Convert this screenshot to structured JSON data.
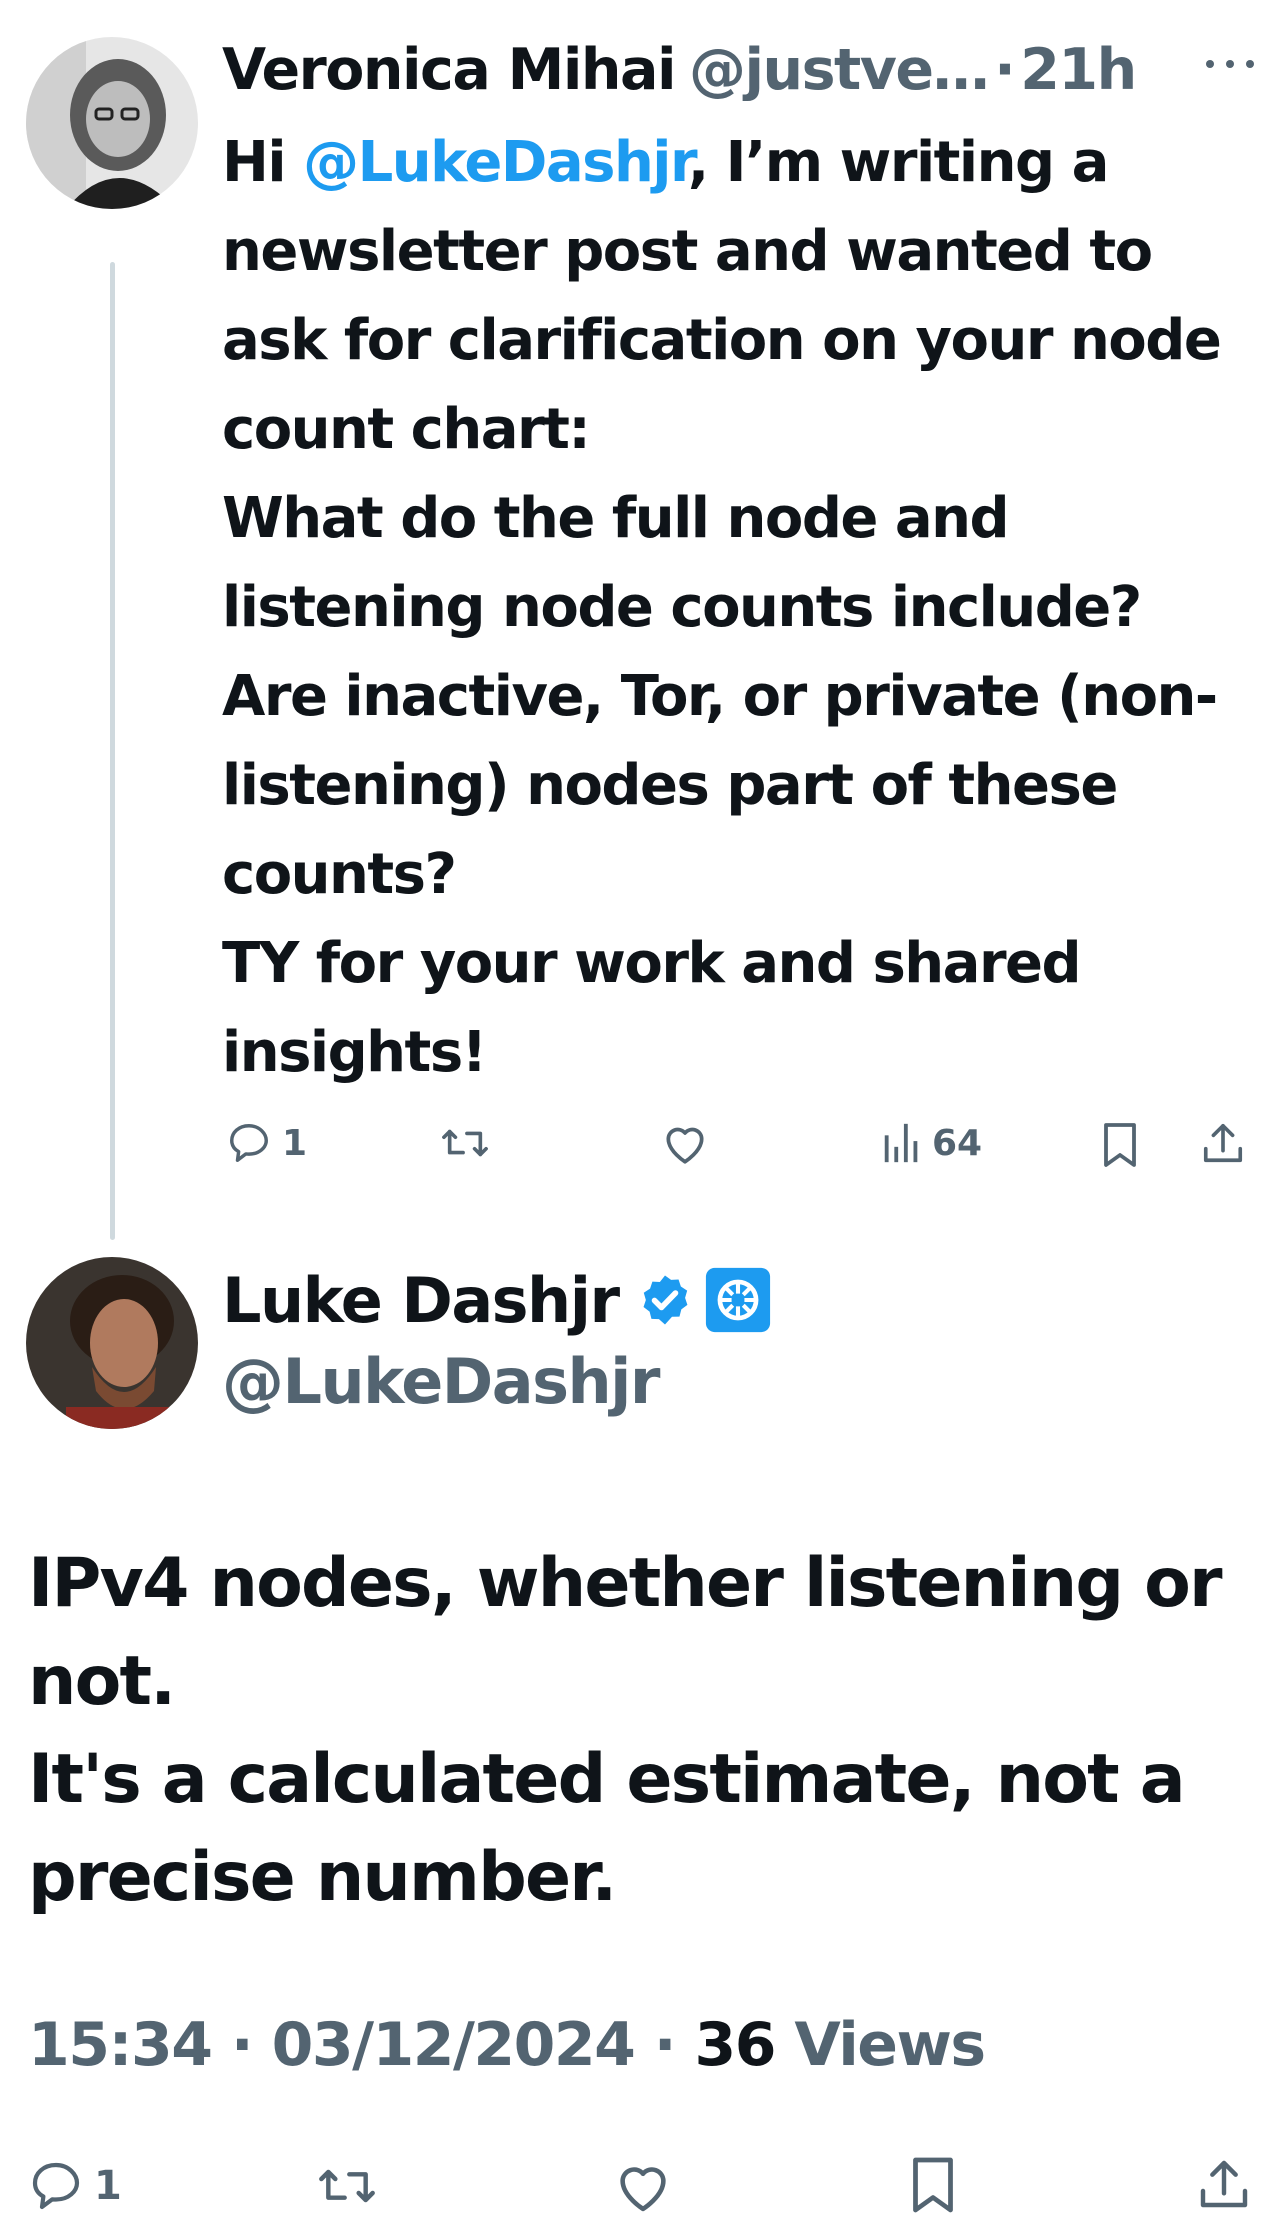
{
  "reply": {
    "author_name": "Veronica Mihai",
    "author_handle": "@justve…",
    "separator": "·",
    "time": "21h",
    "body": {
      "greeting": "Hi ",
      "mention": "@LukeDashjr",
      "line1_rest": ", I’m writing a newsletter post and wanted to ask for clarification on your node count chart:",
      "line2": "What do the full node and listening node counts include?",
      "line3": "Are inactive, Tor, or private (non-listening) nodes part of these counts?",
      "line4": "TY for your work and shared insights!"
    },
    "actions": {
      "reply_count": "1",
      "views_count": "64"
    }
  },
  "main": {
    "author_name": "Luke Dashjr",
    "author_handle": "@LukeDashjr",
    "body": {
      "p1": "IPv4 nodes, whether listening or not.",
      "p2": "It's a calculated estimate, not a precise number."
    },
    "time": "15:34",
    "separator": "·",
    "date": "03/12/2024",
    "views_count": "36",
    "views_label": "Views",
    "actions": {
      "reply_count": "1"
    }
  },
  "colors": {
    "accent": "#1d9bf0",
    "text": "#0f1419",
    "muted": "#536471",
    "thread_line": "#cfd9de"
  },
  "icons": {
    "more": "more-horizontal-icon",
    "reply": "comment-icon",
    "retweet": "retweet-icon",
    "like": "heart-icon",
    "views": "analytics-bars-icon",
    "bookmark": "bookmark-icon",
    "share": "share-icon",
    "verified": "verified-badge-icon",
    "affiliate": "affiliate-logo-icon"
  }
}
